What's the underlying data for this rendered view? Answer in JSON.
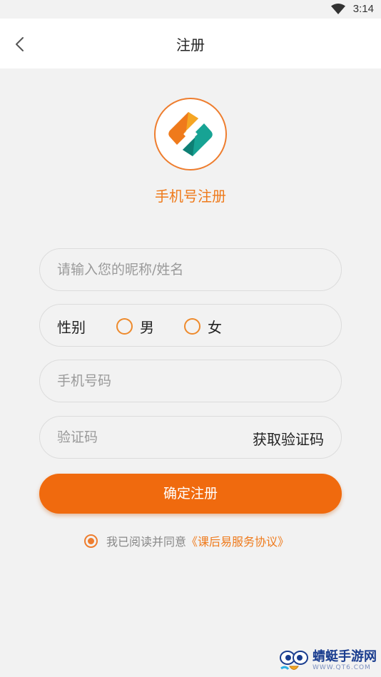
{
  "status": {
    "time": "3:14",
    "wifi_icon": "wifi-icon"
  },
  "nav": {
    "title": "注册",
    "back_icon": "back-chevron-icon"
  },
  "header": {
    "caption": "手机号注册"
  },
  "form": {
    "nickname_placeholder": "请输入您的昵称/姓名",
    "gender_label": "性别",
    "gender_male": "男",
    "gender_female": "女",
    "phone_placeholder": "手机号码",
    "code_placeholder": "验证码",
    "get_code_label": "获取验证码",
    "submit_label": "确定注册"
  },
  "agreement": {
    "prefix": "我已阅读并同意",
    "link": "《课后易服务协议》",
    "checked": true
  },
  "watermark": {
    "name": "蜻蜓手游网",
    "url": "WWW.QT6.COM"
  },
  "colors": {
    "accent": "#f06a0e",
    "accent_text": "#ef7a1b",
    "logo_teal": "#17a394"
  }
}
